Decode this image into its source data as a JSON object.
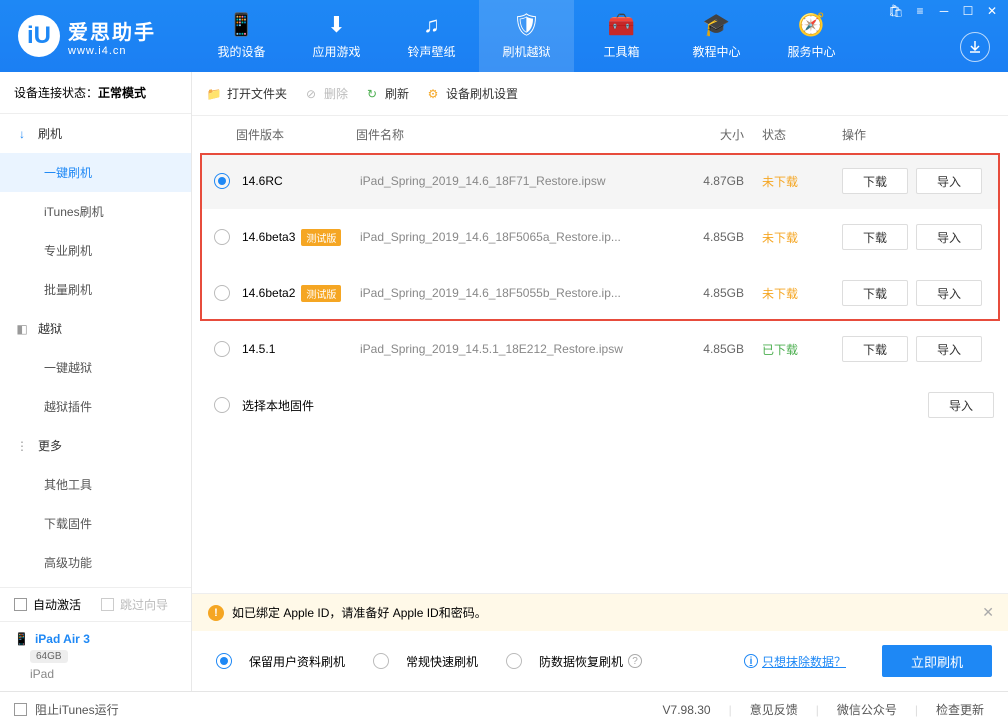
{
  "logo": {
    "title": "爱思助手",
    "sub": "www.i4.cn"
  },
  "nav": [
    {
      "icon": "📱",
      "label": "我的设备"
    },
    {
      "icon": "⬇",
      "label": "应用游戏"
    },
    {
      "icon": "♫",
      "label": "铃声壁纸"
    },
    {
      "icon": "🛡",
      "label": "刷机越狱"
    },
    {
      "icon": "🧰",
      "label": "工具箱"
    },
    {
      "icon": "🎓",
      "label": "教程中心"
    },
    {
      "icon": "🧭",
      "label": "服务中心"
    }
  ],
  "status": {
    "label": "设备连接状态：",
    "value": "正常模式"
  },
  "sidebar": {
    "groups": [
      {
        "icon": "↓",
        "label": "刷机",
        "items": [
          "一键刷机",
          "iTunes刷机",
          "专业刷机",
          "批量刷机"
        ]
      },
      {
        "icon": "◧",
        "label": "越狱",
        "gray": true,
        "items": [
          "一键越狱",
          "越狱插件"
        ]
      },
      {
        "icon": "⋮",
        "label": "更多",
        "gray": true,
        "items": [
          "其他工具",
          "下载固件",
          "高级功能"
        ]
      }
    ],
    "activeSub": "一键刷机",
    "autoActivate": "自动激活",
    "skipGuide": "跳过向导",
    "device": {
      "name": "iPad Air 3",
      "storage": "64GB",
      "type": "iPad"
    },
    "blockItunes": "阻止iTunes运行"
  },
  "toolbar": {
    "open": "打开文件夹",
    "delete": "删除",
    "refresh": "刷新",
    "settings": "设备刷机设置"
  },
  "table": {
    "headers": {
      "ver": "固件版本",
      "name": "固件名称",
      "size": "大小",
      "status": "状态",
      "ops": "操作"
    },
    "rows": [
      {
        "sel": true,
        "ver": "14.6RC",
        "beta": "",
        "name": "iPad_Spring_2019_14.6_18F71_Restore.ipsw",
        "size": "4.87GB",
        "status": "未下载",
        "statusCls": "orange",
        "dl": "下载",
        "imp": "导入"
      },
      {
        "sel": false,
        "ver": "14.6beta3",
        "beta": "测试版",
        "name": "iPad_Spring_2019_14.6_18F5065a_Restore.ip...",
        "size": "4.85GB",
        "status": "未下载",
        "statusCls": "orange",
        "dl": "下载",
        "imp": "导入"
      },
      {
        "sel": false,
        "ver": "14.6beta2",
        "beta": "测试版",
        "name": "iPad_Spring_2019_14.6_18F5055b_Restore.ip...",
        "size": "4.85GB",
        "status": "未下载",
        "statusCls": "orange",
        "dl": "下载",
        "imp": "导入"
      },
      {
        "sel": false,
        "ver": "14.5.1",
        "beta": "",
        "name": "iPad_Spring_2019_14.5.1_18E212_Restore.ipsw",
        "size": "4.85GB",
        "status": "已下载",
        "statusCls": "green",
        "dl": "下载",
        "imp": "导入"
      },
      {
        "sel": false,
        "ver": "选择本地固件",
        "beta": "",
        "name": "",
        "size": "",
        "status": "",
        "statusCls": "",
        "dl": "",
        "imp": "导入"
      }
    ]
  },
  "warn": "如已绑定 Apple ID，请准备好 Apple ID和密码。",
  "flash": {
    "opts": [
      "保留用户资料刷机",
      "常规快速刷机",
      "防数据恢复刷机"
    ],
    "activeOpt": 0,
    "erase": "只想抹除数据？",
    "go": "立即刷机"
  },
  "footer": {
    "version": "V7.98.30",
    "feedback": "意见反馈",
    "wechat": "微信公众号",
    "update": "检查更新"
  }
}
